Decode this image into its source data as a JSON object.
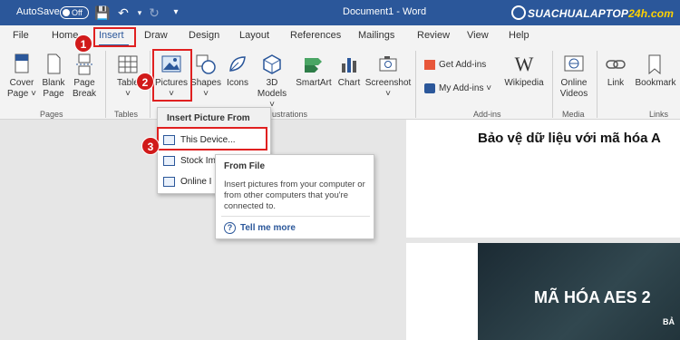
{
  "titlebar": {
    "autosave_label": "AutoSave",
    "autosave_state": "Off",
    "document_title": "Document1 - Word",
    "brand_left": "SUACHUALAPTOP",
    "brand_right": "24h.com"
  },
  "tabs": [
    "File",
    "Home",
    "Insert",
    "Draw",
    "Design",
    "Layout",
    "References",
    "Mailings",
    "Review",
    "View",
    "Help"
  ],
  "active_tab": "Insert",
  "ribbon": {
    "pages": {
      "cover_page": "Cover",
      "cover_page2": "Page",
      "blank": "Blank",
      "blank2": "Page",
      "break": "Page",
      "break2": "Break",
      "group": "Pages"
    },
    "tables": {
      "table": "Table",
      "group": "Tables"
    },
    "illustrations": {
      "pictures": "Pictures",
      "shapes": "Shapes",
      "icons": "Icons",
      "models": "3D",
      "models2": "Models",
      "smartart": "SmartArt",
      "chart": "Chart",
      "screenshot": "Screenshot",
      "group": "ustrations"
    },
    "addins": {
      "get": "Get Add-ins",
      "my": "My Add-ins",
      "wikipedia": "Wikipedia",
      "group": "Add-ins"
    },
    "media": {
      "online": "Online",
      "online2": "Videos",
      "group": "Media"
    },
    "links": {
      "link": "Link",
      "bookmark": "Bookmark",
      "group": "Links"
    }
  },
  "insert_menu": {
    "header": "Insert Picture From",
    "items": [
      "This Device...",
      "Stock Im",
      "Online I"
    ]
  },
  "tooltip": {
    "title": "From File",
    "body": "Insert pictures from your computer or from other computers that you're connected to.",
    "tell_more": "Tell me more"
  },
  "document": {
    "heading": "Bảo vệ dữ liệu với mã hóa A",
    "image_text": "MÃ HÓA  AES 2",
    "image_subtext": "BẢ"
  },
  "steps": [
    "1",
    "2",
    "3"
  ],
  "colors": {
    "accent": "#2b579a",
    "highlight": "#e02020",
    "step_badge": "#d11a1a"
  }
}
